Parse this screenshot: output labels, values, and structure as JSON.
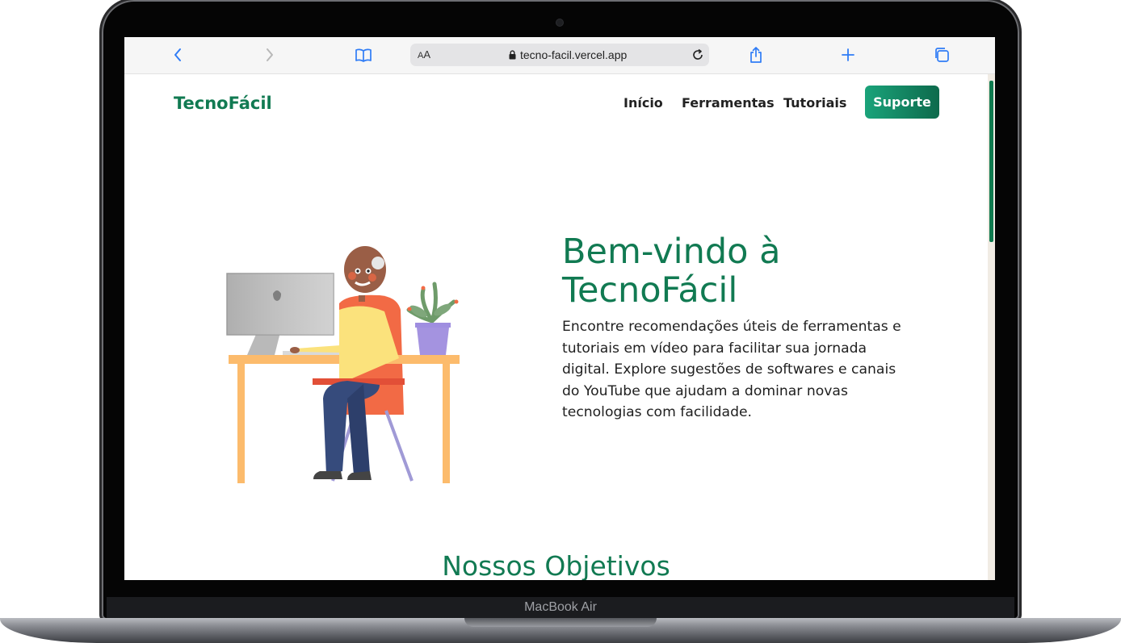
{
  "device": {
    "model_label": "MacBook Air"
  },
  "browser": {
    "text_size_label_small": "A",
    "text_size_label_big": "A",
    "url": "tecno-facil.vercel.app",
    "icons": [
      "chevron-left-icon",
      "chevron-right-icon",
      "book-icon",
      "lock-icon",
      "reload-icon",
      "share-icon",
      "plus-icon",
      "tabs-icon"
    ],
    "accent_color": "#2f7cf6"
  },
  "site": {
    "logo": "TecnoFácil",
    "nav": {
      "inicio": "Início",
      "ferramentas": "Ferramentas",
      "tutoriais": "Tutoriais",
      "suporte": "Suporte"
    },
    "hero": {
      "title": "Bem-vindo à TecnoFácil",
      "text": "Encontre recomendações úteis de ferramentas e tutoriais em vídeo para facilitar sua jornada digital. Explore sugestões de softwares e canais do YouTube que ajudam a dominar novas tecnologias com facilidade."
    },
    "section_title": "Nossos Objetivos",
    "brand_color": "#117a52"
  }
}
